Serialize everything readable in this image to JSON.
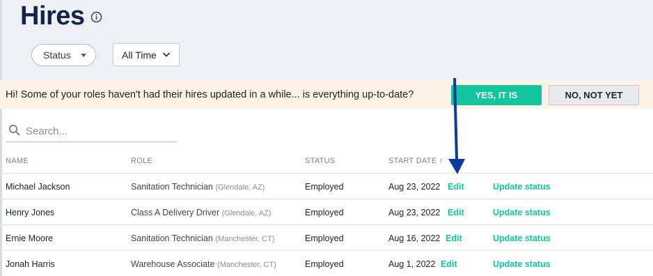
{
  "page": {
    "title": "Hires",
    "info_icon": "info-icon"
  },
  "filters": {
    "status_label": "Status",
    "time_label": "All Time"
  },
  "banner": {
    "message": "Hi! Some of your roles haven't had their hires updated in a while... is everything up-to-date?",
    "yes_label": "YES, IT IS",
    "no_label": "NO, NOT YET"
  },
  "search": {
    "placeholder": "Search...",
    "icon": "search-icon"
  },
  "table": {
    "headers": {
      "name": "NAME",
      "role": "ROLE",
      "status": "STATUS",
      "start_date": "START DATE ↑"
    },
    "rows": [
      {
        "name": "Michael Jackson",
        "role": "Sanitation Technician",
        "location": "(Glendale, AZ)",
        "status": "Employed",
        "start_date": "Aug 23, 2022",
        "edit": "Edit",
        "update": "Update status"
      },
      {
        "name": "Henry Jones",
        "role": "Class A Delivery Driver",
        "location": "(Glendale, AZ)",
        "status": "Employed",
        "start_date": "Aug 23, 2022",
        "edit": "Edit",
        "update": "Update status"
      },
      {
        "name": "Ernie Moore",
        "role": "Sanitation Technician",
        "location": "(Manchester, CT)",
        "status": "Employed",
        "start_date": "Aug 16, 2022",
        "edit": "Edit",
        "update": "Update status"
      },
      {
        "name": "Jonah Harris",
        "role": "Warehouse Associate",
        "location": "(Manchester, CT)",
        "status": "Employed",
        "start_date": "Aug 1, 2022",
        "edit": "Edit",
        "update": "Update status"
      }
    ]
  },
  "colors": {
    "accent": "#13c59c",
    "title": "#13244a",
    "header_bg": "#eff0f6",
    "banner_bg": "#fdf3e6",
    "annotation_arrow": "#0d3a9c"
  }
}
